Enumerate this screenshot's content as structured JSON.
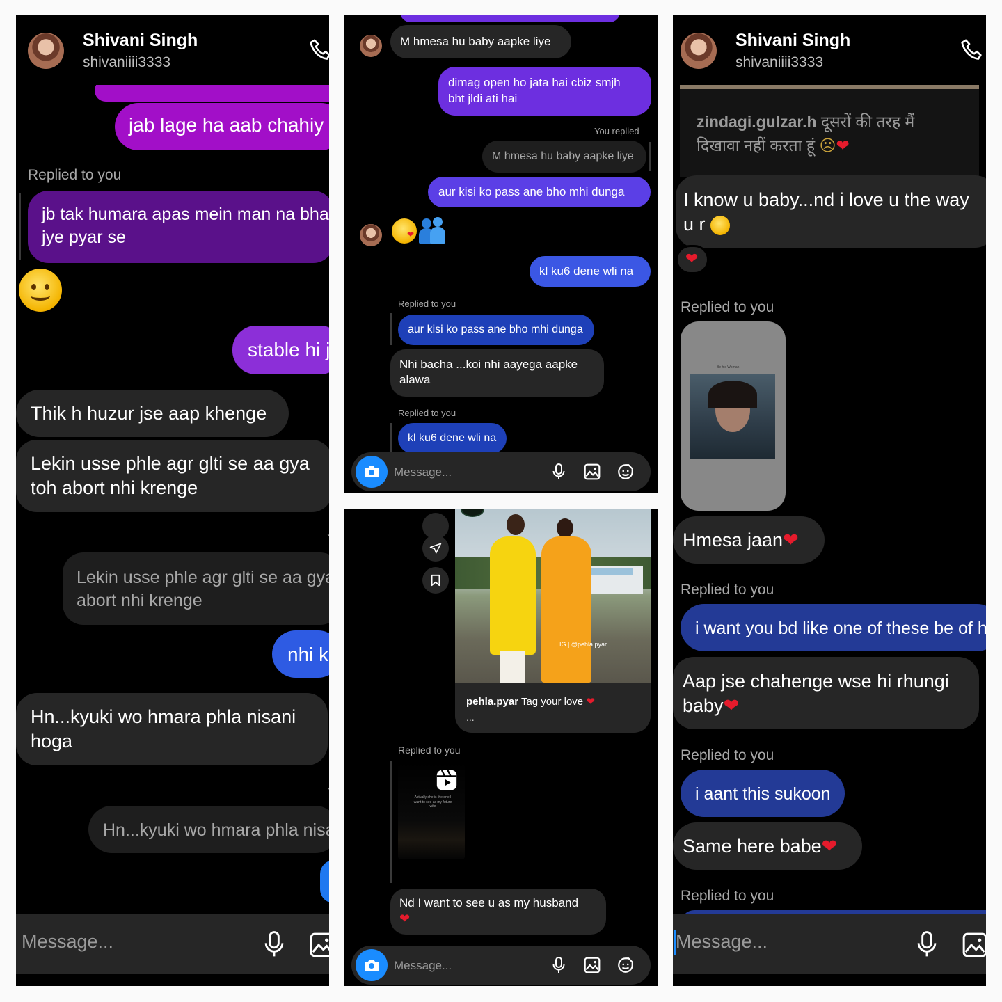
{
  "panel1": {
    "contact_name": "Shivani Singh",
    "username": "shivaniiii3333",
    "msg_partial_top": "jab lage ha  aab chahiy",
    "replied_label_1": "Replied to you",
    "msg_reply_1": "jb tak humara apas mein man na bhar",
    "msg_reply_1b": "jye pyar se",
    "msg_stable": "stable hi j",
    "msg_thik": "Thik h huzur jse aap khenge",
    "msg_lekin_1": "Lekin usse phle agr glti se aa gya",
    "msg_lekin_2": "toh abort nhi krenge",
    "quoted_lekin_1": "Lekin usse phle agr glti se aa gya",
    "quoted_lekin_2": "abort nhi krenge",
    "msg_nhi": "nhi k",
    "msg_hn_1": "Hn...kyuki wo hmara phla nisani",
    "msg_hn_2": "hoga",
    "quoted_hn": "Hn...kyuki wo hmara phla nisa",
    "input_placeholder": "Message..."
  },
  "panel2": {
    "msg_hmesa": "M hmesa hu baby aapke liye",
    "msg_dimag_1": "dimag open ho jata hai cbiz smjh",
    "msg_dimag_2": "bht jldi ati hai",
    "you_replied": "You replied",
    "quoted_hmesa": "M hmesa hu baby aapke liye",
    "msg_aur": "aur kisi ko pass ane bho mhi dunga",
    "msg_kl": "kl ku6 dene wli na",
    "replied_label_1": "Replied to you",
    "quoted_aur": "aur kisi ko pass ane bho mhi dunga",
    "msg_nhi_1": "Nhi bacha ...koi nhi aayega aapke",
    "msg_nhi_2": "alawa",
    "replied_label_2": "Replied to you",
    "quoted_kl": "kl ku6 dene wli na",
    "input_placeholder": "Message..."
  },
  "panel3": {
    "post_watermark": "IG | @pehla.pyar",
    "post_author": "pehla.pyar",
    "post_caption": "Tag your love",
    "post_more": "...",
    "replied_label": "Replied to you",
    "reel_text": "Actually she is the one I want to see as my future wife",
    "msg_nd": "Nd I want to see u as my husband",
    "input_placeholder": "Message..."
  },
  "panel4": {
    "contact_name": "Shivani Singh",
    "username": "shivaniiii3333",
    "reel_author": "zindagi.gulzar.h",
    "reel_caption_1": "दूसरों की तरह मैं",
    "reel_caption_2": "दिखावा नहीं करता हूं",
    "msg_know_1": "I know u baby...nd i love u the way",
    "msg_know_2": "u r",
    "replied_label_1": "Replied to you",
    "shared_post_title": "Be his Woman",
    "msg_hmesa": "Hmesa jaan",
    "replied_label_2": "Replied to you",
    "msg_want": "i want you bd like one of these be of hi",
    "msg_aap_1": "Aap jse chahenge wse hi rhungi",
    "msg_aap_2": "baby",
    "replied_label_3": "Replied to you",
    "msg_aant": "i aant this sukoon",
    "msg_same": "Same here babe",
    "replied_label_4": "Replied to you",
    "input_placeholder": "Message..."
  },
  "colors": {
    "background": "#000000",
    "gray_bubble": "#262626",
    "purple": "#a20fc8",
    "blue": "#3055e0",
    "camera_blue": "#1a8cff"
  }
}
